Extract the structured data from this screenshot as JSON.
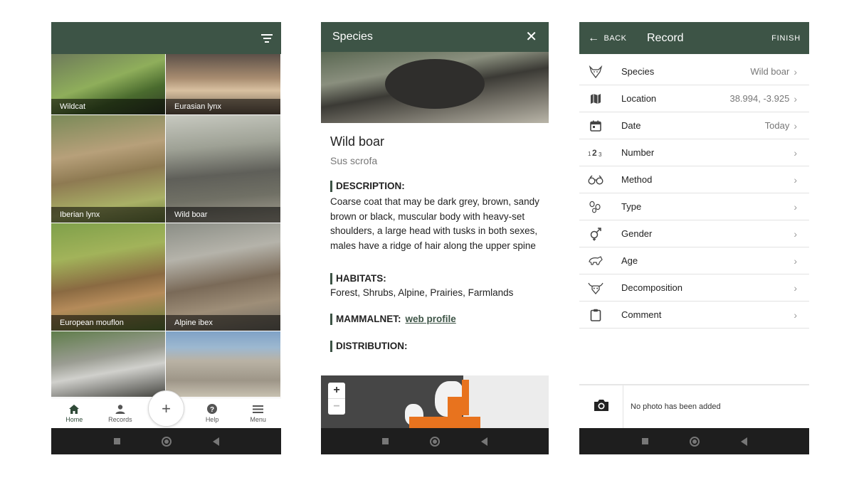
{
  "screen1": {
    "tiles": [
      {
        "name": "Wildcat"
      },
      {
        "name": "Eurasian lynx"
      },
      {
        "name": "Iberian lynx"
      },
      {
        "name": "Wild boar"
      },
      {
        "name": "European mouflon"
      },
      {
        "name": "Alpine ibex"
      },
      {
        "name": ""
      },
      {
        "name": ""
      }
    ],
    "tabs": {
      "home": "Home",
      "records": "Records",
      "add": "+",
      "help": "Help",
      "menu": "Menu"
    },
    "icons": {
      "filter": "filter-icon",
      "home": "home-icon",
      "records": "person-icon",
      "help": "help-icon",
      "menu": "menu-icon"
    }
  },
  "screen2": {
    "title": "Species",
    "close": "✕",
    "species_name": "Wild boar",
    "latin_name": "Sus scrofa",
    "description_label": "DESCRIPTION:",
    "description": "Coarse coat that may be dark grey, brown, sandy brown or black, muscular body with heavy-set shoulders, a large head with tusks in both sexes, males have a ridge of hair along the upper spine",
    "habitats_label": "HABITATS:",
    "habitats": "Forest, Shrubs, Alpine, Prairies, Farmlands",
    "mammalnet_label": "MAMMALNET:",
    "mammalnet_link": "web profile",
    "distribution_label": "DISTRIBUTION:",
    "map_zoom_in": "+",
    "map_zoom_out": "−"
  },
  "screen3": {
    "back": "BACK",
    "title": "Record",
    "finish": "FINISH",
    "rows": [
      {
        "label": "Species",
        "value": "Wild boar",
        "icon": "boar-head-icon"
      },
      {
        "label": "Location",
        "value": "38.994, -3.925",
        "icon": "map-icon"
      },
      {
        "label": "Date",
        "value": "Today",
        "icon": "calendar-icon"
      },
      {
        "label": "Number",
        "value": "",
        "icon": "number-icon"
      },
      {
        "label": "Method",
        "value": "",
        "icon": "binoculars-icon"
      },
      {
        "label": "Type",
        "value": "",
        "icon": "tracks-icon"
      },
      {
        "label": "Gender",
        "value": "",
        "icon": "gender-icon"
      },
      {
        "label": "Age",
        "value": "",
        "icon": "age-icon"
      },
      {
        "label": "Decomposition",
        "value": "",
        "icon": "skull-icon"
      },
      {
        "label": "Comment",
        "value": "",
        "icon": "clipboard-icon"
      }
    ],
    "photo_text": "No photo has been added"
  },
  "colors": {
    "primary": "#3d5446",
    "navbar": "#1e1e1e",
    "map_orange": "#e8731e"
  }
}
